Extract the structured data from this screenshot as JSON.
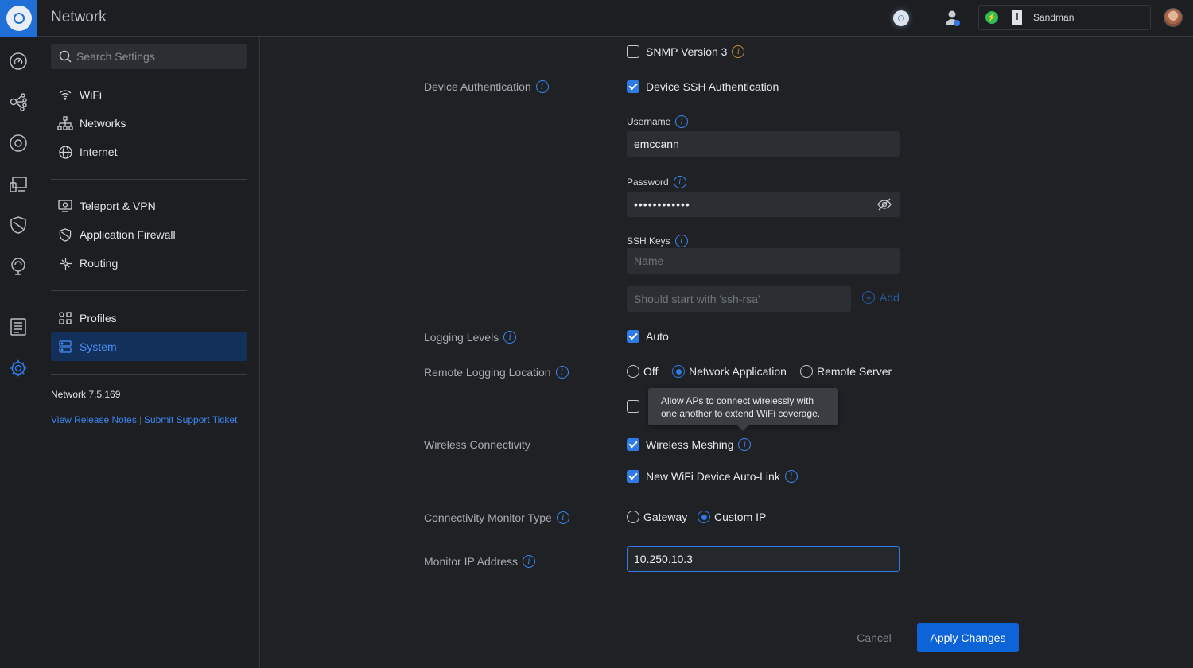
{
  "app": {
    "title": "Network"
  },
  "topbar": {
    "console_name": "Sandman",
    "icons": [
      "globe-icon",
      "user-admin-icon",
      "bolt-icon",
      "device-icon",
      "avatar"
    ]
  },
  "rail": {
    "icons": [
      "dashboard-icon",
      "topology-icon",
      "devices-icon",
      "clients-icon",
      "security-icon",
      "insights-icon",
      "logs-icon",
      "settings-icon"
    ]
  },
  "nav": {
    "search_placeholder": "Search Settings",
    "items": [
      {
        "label": "WiFi",
        "icon": "wifi-icon"
      },
      {
        "label": "Networks",
        "icon": "networks-icon"
      },
      {
        "label": "Internet",
        "icon": "globe-icon"
      },
      {
        "label": "Teleport & VPN",
        "icon": "teleport-icon"
      },
      {
        "label": "Application Firewall",
        "icon": "shield-icon"
      },
      {
        "label": "Routing",
        "icon": "routing-icon"
      },
      {
        "label": "Profiles",
        "icon": "profiles-icon"
      },
      {
        "label": "System",
        "icon": "system-icon",
        "active": true
      }
    ],
    "version": "Network 7.5.169",
    "release_notes": "View Release Notes",
    "pipe": "|",
    "support": "Submit Support Ticket"
  },
  "form": {
    "snmp_v3": "SNMP Version 3",
    "device_auth": {
      "label": "Device Authentication",
      "ssh_auth": "Device SSH Authentication"
    },
    "username": {
      "label": "Username",
      "value": "emccann"
    },
    "password": {
      "label": "Password",
      "value": "••••••••••••"
    },
    "ssh_keys": {
      "label": "SSH Keys",
      "name_placeholder": "Name",
      "key_placeholder": "Should start with 'ssh-rsa'",
      "add": "Add"
    },
    "logging_levels": {
      "label": "Logging Levels",
      "auto": "Auto"
    },
    "remote_logging": {
      "label": "Remote Logging Location",
      "off": "Off",
      "network_app": "Network Application",
      "remote_server": "Remote Server"
    },
    "tooltip": "Allow APs to connect wirelessly with one another to extend WiFi coverage.",
    "wireless_connectivity": {
      "label": "Wireless Connectivity",
      "meshing": "Wireless Meshing",
      "auto_link": "New WiFi Device Auto-Link"
    },
    "monitor_type": {
      "label": "Connectivity Monitor Type",
      "gateway": "Gateway",
      "custom_ip": "Custom IP"
    },
    "monitor_ip": {
      "label": "Monitor IP Address",
      "value": "10.250.10.3"
    },
    "cancel": "Cancel",
    "apply": "Apply Changes"
  },
  "colors": {
    "accent": "#2f7ae5",
    "apply": "#0d63d8",
    "active_nav_bg": "#13305b",
    "success": "#2fbd55"
  }
}
